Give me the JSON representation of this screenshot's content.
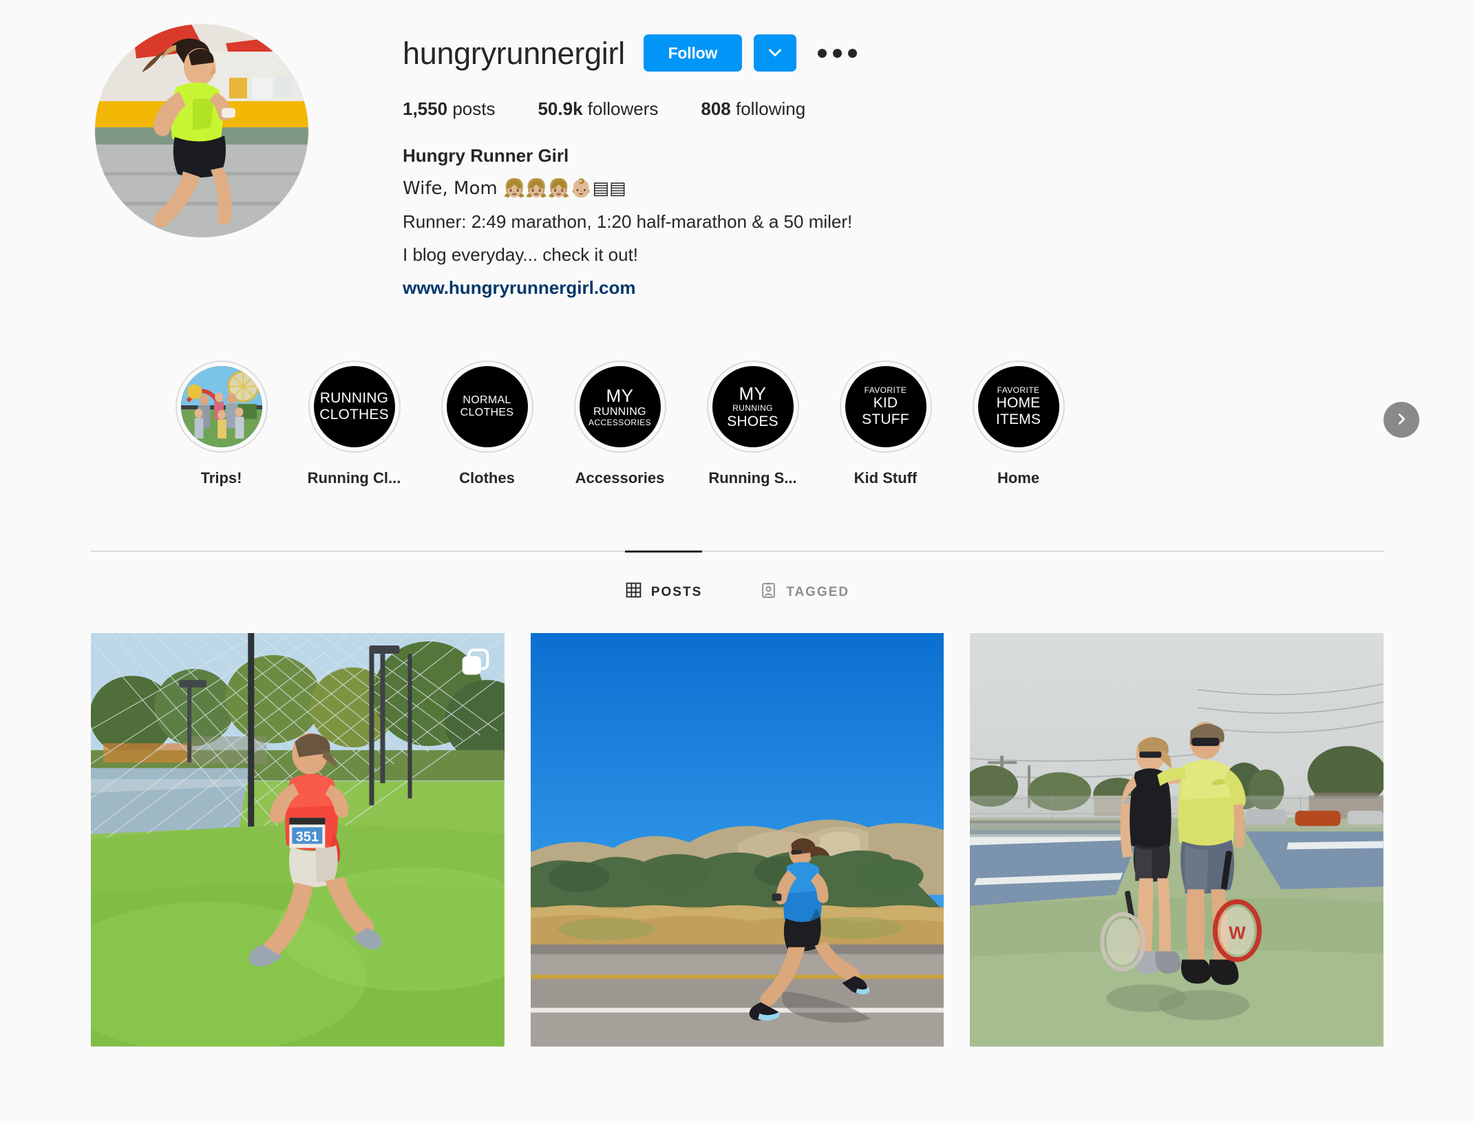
{
  "profile": {
    "username": "hungryrunnergirl",
    "avatar_alt": "runner-profile-photo",
    "follow_label": "Follow",
    "dropdown_icon": "chevron-down-icon",
    "options_icon": "more-options-icon",
    "stats": [
      {
        "value": "1,550",
        "label": "posts"
      },
      {
        "value": "50.9k",
        "label": "followers"
      },
      {
        "value": "808",
        "label": "following"
      }
    ],
    "bio": {
      "full_name": "Hungry Runner Girl",
      "line1": "Wife, Mom 👧🏼👧🏼👧🏼👶🏼▤▤",
      "line2": "Runner: 2:49 marathon, 1:20 half-marathon & a 50 miler!",
      "line3": "I blog everyday... check it out!",
      "website": "www.hungryrunnergirl.com"
    }
  },
  "highlights": {
    "next_icon": "chevron-right-icon",
    "items": [
      {
        "label": "Trips!",
        "cover_type": "photo",
        "cover_text": []
      },
      {
        "label": "Running Cl...",
        "cover_type": "text",
        "cover_text": [
          "RUNNING",
          "CLOTHES"
        ]
      },
      {
        "label": "Clothes",
        "cover_type": "text",
        "cover_text": [
          "NORMAL",
          "CLOTHES"
        ]
      },
      {
        "label": "Accessories",
        "cover_type": "text",
        "cover_text": [
          "MY",
          "RUNNING",
          "ACCESSORIES"
        ]
      },
      {
        "label": "Running S...",
        "cover_type": "text",
        "cover_text": [
          "MY",
          "RUNNING",
          "SHOES"
        ]
      },
      {
        "label": "Kid Stuff",
        "cover_type": "text",
        "cover_text": [
          "FAVORITE",
          "KID",
          "STUFF"
        ]
      },
      {
        "label": "Home",
        "cover_type": "text",
        "cover_text": [
          "FAVORITE",
          "HOME",
          "ITEMS"
        ]
      }
    ]
  },
  "tabs": [
    {
      "label": "POSTS",
      "icon": "grid-icon",
      "active": true
    },
    {
      "label": "TAGGED",
      "icon": "tagged-person-icon",
      "active": false
    }
  ],
  "posts": [
    {
      "alt": "girl-running-race-on-grass",
      "multi": true
    },
    {
      "alt": "woman-running-on-desert-road",
      "multi": false
    },
    {
      "alt": "couple-with-tennis-rackets-on-court",
      "multi": false
    }
  ],
  "colors": {
    "accent": "#0095f6",
    "link": "#00376b",
    "text": "#262626",
    "muted": "#8e8e8e",
    "border": "#dbdbdb",
    "background": "#fafafa"
  }
}
